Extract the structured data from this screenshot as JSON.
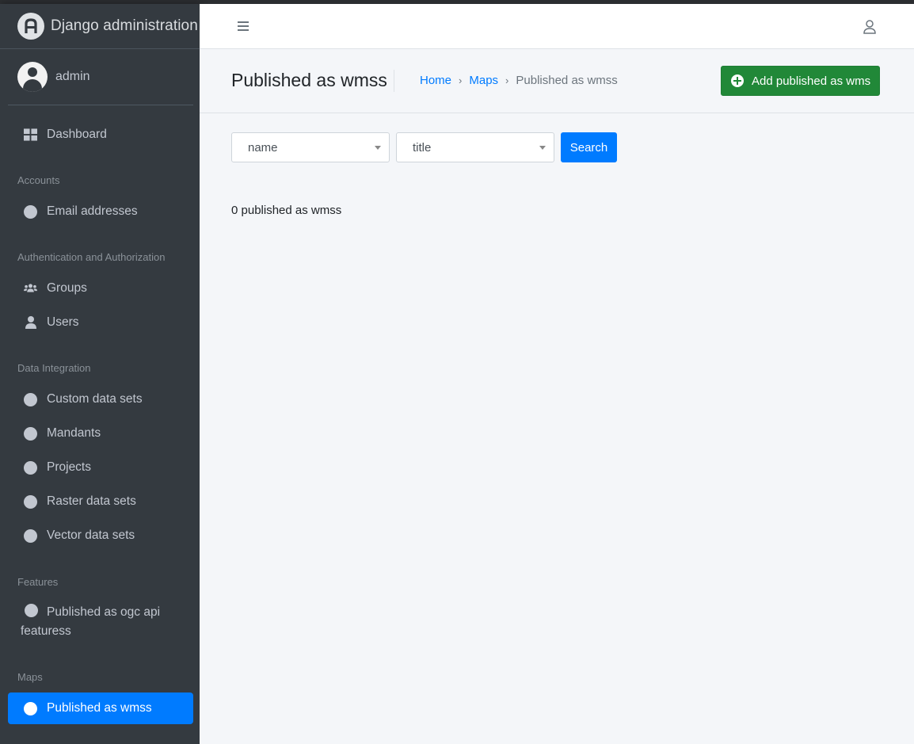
{
  "app": {
    "title": "Django administration"
  },
  "user": {
    "name": "admin"
  },
  "sidebar": {
    "dashboard": "Dashboard",
    "sections": [
      {
        "header": "Accounts",
        "items": [
          "Email addresses"
        ]
      },
      {
        "header": "Authentication and Authorization",
        "items": [
          "Groups",
          "Users"
        ]
      },
      {
        "header": "Data Integration",
        "items": [
          "Custom data sets",
          "Mandants",
          "Projects",
          "Raster data sets",
          "Vector data sets"
        ]
      },
      {
        "header": "Features",
        "items": [
          "Published as ogc api featuress"
        ]
      },
      {
        "header": "Maps",
        "items": [
          "Published as wmss"
        ]
      }
    ],
    "active_item": "Published as wmss"
  },
  "header": {
    "page_title": "Published as wmss",
    "breadcrumb": [
      "Home",
      "Maps",
      "Published as wmss"
    ],
    "add_button": "Add published as wms"
  },
  "filters": {
    "name_select": "name",
    "title_select": "title",
    "search_button": "Search"
  },
  "result": {
    "count_text": "0 published as wmss"
  },
  "colors": {
    "sidebar_bg": "#343a40",
    "active_bg": "#007bff",
    "add_button_bg": "#218838",
    "content_bg": "#f4f6f9"
  }
}
